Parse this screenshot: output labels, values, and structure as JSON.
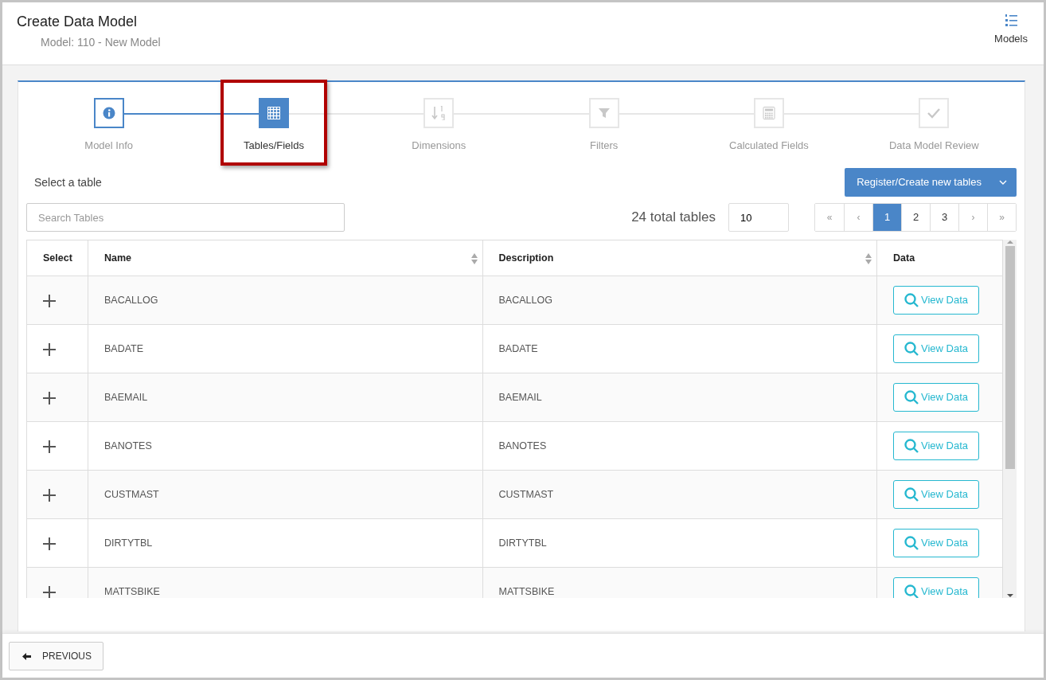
{
  "header": {
    "title": "Create Data Model",
    "subtitle": "Model: 110 - New Model",
    "models_button": "Models"
  },
  "steps": [
    {
      "label": "Model Info",
      "completed": true,
      "selected": false,
      "highlighted": false
    },
    {
      "label": "Tables/Fields",
      "completed": false,
      "selected": true,
      "highlighted": true
    },
    {
      "label": "Dimensions",
      "completed": false,
      "selected": false,
      "highlighted": false
    },
    {
      "label": "Filters",
      "completed": false,
      "selected": false,
      "highlighted": false
    },
    {
      "label": "Calculated Fields",
      "completed": false,
      "selected": false,
      "highlighted": false
    },
    {
      "label": "Data Model Review",
      "completed": false,
      "selected": false,
      "highlighted": false
    }
  ],
  "section_label": "Select a table",
  "register_button": "Register/Create new tables",
  "search": {
    "placeholder": "Search Tables"
  },
  "total_label": "24 total tables",
  "page_size": "10",
  "pagination": [
    {
      "label": "«",
      "selected": false
    },
    {
      "label": "‹",
      "selected": false
    },
    {
      "label": "1",
      "selected": true
    },
    {
      "label": "2",
      "selected": false
    },
    {
      "label": "3",
      "selected": false
    },
    {
      "label": "›",
      "selected": false
    },
    {
      "label": "»",
      "selected": false
    }
  ],
  "table": {
    "columns": [
      {
        "label": "Select",
        "sortable": false
      },
      {
        "label": "Name",
        "sortable": true
      },
      {
        "label": "Description",
        "sortable": true
      },
      {
        "label": "Data",
        "sortable": false
      }
    ],
    "rows": [
      {
        "name": "BACALLOG",
        "description": "BACALLOG",
        "action": "View Data"
      },
      {
        "name": "BADATE",
        "description": "BADATE",
        "action": "View Data"
      },
      {
        "name": "BAEMAIL",
        "description": "BAEMAIL",
        "action": "View Data"
      },
      {
        "name": "BANOTES",
        "description": "BANOTES",
        "action": "View Data"
      },
      {
        "name": "CUSTMAST",
        "description": "CUSTMAST",
        "action": "View Data"
      },
      {
        "name": "DIRTYTBL",
        "description": "DIRTYTBL",
        "action": "View Data"
      },
      {
        "name": "MATTSBIKE",
        "description": "MATTSBIKE",
        "action": "View Data"
      }
    ]
  },
  "footer": {
    "previous_button": "PREVIOUS"
  }
}
